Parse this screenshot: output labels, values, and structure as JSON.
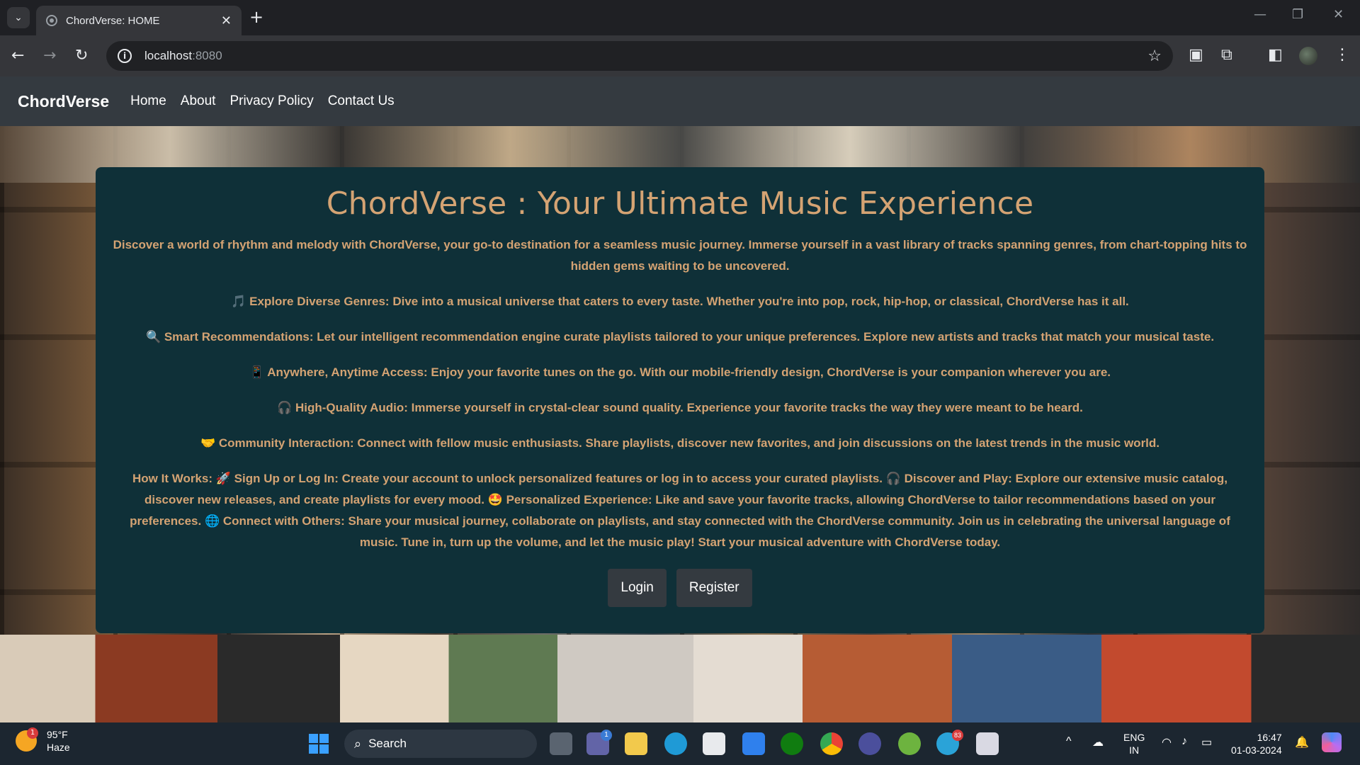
{
  "browser": {
    "tab_title": "ChordVerse: HOME",
    "tab_close": "✕",
    "new_tab": "+",
    "url_host": "localhost",
    "url_port": ":8080"
  },
  "navbar": {
    "brand": "ChordVerse",
    "links": [
      "Home",
      "About",
      "Privacy Policy",
      "Contact Us"
    ]
  },
  "hero": {
    "title": "ChordVerse : Your Ultimate Music Experience",
    "intro": "Discover a world of rhythm and melody with ChordVerse, your go-to destination for a seamless music journey. Immerse yourself in a vast library of tracks spanning genres, from chart-topping hits to hidden gems waiting to be uncovered.",
    "features": [
      {
        "emoji": "🎵",
        "text": "Explore Diverse Genres: Dive into a musical universe that caters to every taste. Whether you're into pop, rock, hip-hop, or classical, ChordVerse has it all."
      },
      {
        "emoji": "🔍",
        "text": "Smart Recommendations: Let our intelligent recommendation engine curate playlists tailored to your unique preferences. Explore new artists and tracks that match your musical taste."
      },
      {
        "emoji": "📱",
        "text": "Anywhere, Anytime Access: Enjoy your favorite tunes on the go. With our mobile-friendly design, ChordVerse is your companion wherever you are."
      },
      {
        "emoji": "🎧",
        "text": "High-Quality Audio: Immerse yourself in crystal-clear sound quality. Experience your favorite tracks the way they were meant to be heard."
      },
      {
        "emoji": "🤝",
        "text": "Community Interaction: Connect with fellow music enthusiasts. Share playlists, discover new favorites, and join discussions on the latest trends in the music world."
      }
    ],
    "how_it_works": "How It Works: 🚀 Sign Up or Log In: Create your account to unlock personalized features or log in to access your curated playlists. 🎧 Discover and Play: Explore our extensive music catalog, discover new releases, and create playlists for every mood. 🤩 Personalized Experience: Like and save your favorite tracks, allowing ChordVerse to tailor recommendations based on your preferences. 🌐 Connect with Others: Share your musical journey, collaborate on playlists, and stay connected with the ChordVerse community. Join us in celebrating the universal language of music. Tune in, turn up the volume, and let the music play! Start your musical adventure with ChordVerse today.",
    "login_label": "Login",
    "register_label": "Register"
  },
  "taskbar": {
    "weather_badge": "1",
    "temperature": "95°F",
    "condition": "Haze",
    "search_label": "Search",
    "lang_line1": "ENG",
    "lang_line2": "IN",
    "time": "16:47",
    "date": "01-03-2024",
    "teams_badge": "1",
    "telegram_badge": "83"
  },
  "colors": {
    "card_bg": "#0f3038",
    "card_text": "#d4a373",
    "navbar_bg": "#343a40"
  }
}
